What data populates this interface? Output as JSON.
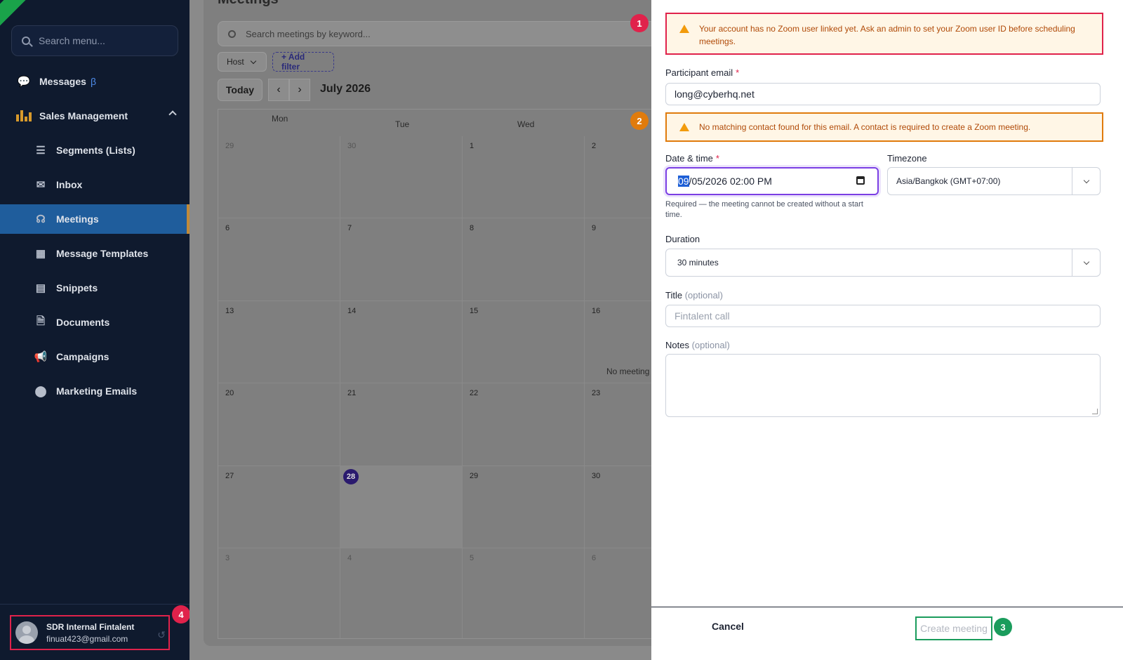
{
  "sidebar": {
    "search_placeholder": "Search menu...",
    "items": [
      {
        "label": "Messages",
        "badge": "β",
        "icon": "chat-bubbles-icon"
      },
      {
        "label": "Sales Management",
        "icon": "bar-chart-icon"
      },
      {
        "label": "Segments (Lists)",
        "icon": "list-icon"
      },
      {
        "label": "Inbox",
        "icon": "inbox-icon"
      },
      {
        "label": "Meetings",
        "icon": "headset-icon",
        "active": true
      },
      {
        "label": "Message Templates",
        "icon": "template-icon"
      },
      {
        "label": "Snippets",
        "icon": "snippet-icon"
      },
      {
        "label": "Documents",
        "icon": "document-icon"
      },
      {
        "label": "Campaigns",
        "icon": "megaphone-icon"
      },
      {
        "label": "Marketing Emails",
        "icon": "circle-icon"
      }
    ],
    "user": {
      "name": "SDR Internal Fintalent",
      "email": "finuat423@gmail.com"
    }
  },
  "main": {
    "title": "Meetings",
    "search_placeholder": "Search meetings by keyword...",
    "filters": {
      "host": "Host",
      "add_filter": "+ Add filter"
    },
    "today_label": "Today",
    "month_label": "July 2026",
    "weekdays": [
      "Mon",
      "Tue",
      "Wed"
    ],
    "weeks": [
      [
        "29",
        "30",
        "1",
        "2"
      ],
      [
        "6",
        "7",
        "8",
        "9"
      ],
      [
        "13",
        "14",
        "15",
        "16"
      ],
      [
        "20",
        "21",
        "22",
        "23"
      ],
      [
        "27",
        "28",
        "29",
        "30"
      ],
      [
        "3",
        "4",
        "5",
        "6"
      ]
    ],
    "no_meetings": "No meeting"
  },
  "panel": {
    "alert_zoom": "Your account has no Zoom user linked yet. Ask an admin to set your Zoom user ID before scheduling meetings.",
    "participant_label": "Participant email",
    "participant_value": "long@cyberhq.net",
    "alert_contact": "No matching contact found for this email. A contact is required to create a Zoom meeting.",
    "datetime_label": "Date & time",
    "datetime_month": "09",
    "datetime_rest": "/05/2026 02:00 PM",
    "timezone_label": "Timezone",
    "timezone_value": "Asia/Bangkok (GMT+07:00)",
    "datetime_helper": "Required — the meeting cannot be created without a start time.",
    "duration_label": "Duration",
    "duration_value": "30 minutes",
    "title_label": "Title",
    "title_optional": "(optional)",
    "title_placeholder": "Fintalent call",
    "notes_label": "Notes",
    "notes_optional": "(optional)",
    "cancel_label": "Cancel",
    "create_label": "Create meeting"
  },
  "annotations": [
    "1",
    "2",
    "3",
    "4"
  ],
  "colors": {
    "sidebar_bg": "#0f1a2e",
    "active_nav": "#1f5d9c",
    "warning_text": "#b04a08",
    "warning_bg": "#fff6e6",
    "annotation_red": "#e0224b",
    "annotation_orange": "#e07b0c",
    "annotation_green": "#1a9c5c"
  }
}
